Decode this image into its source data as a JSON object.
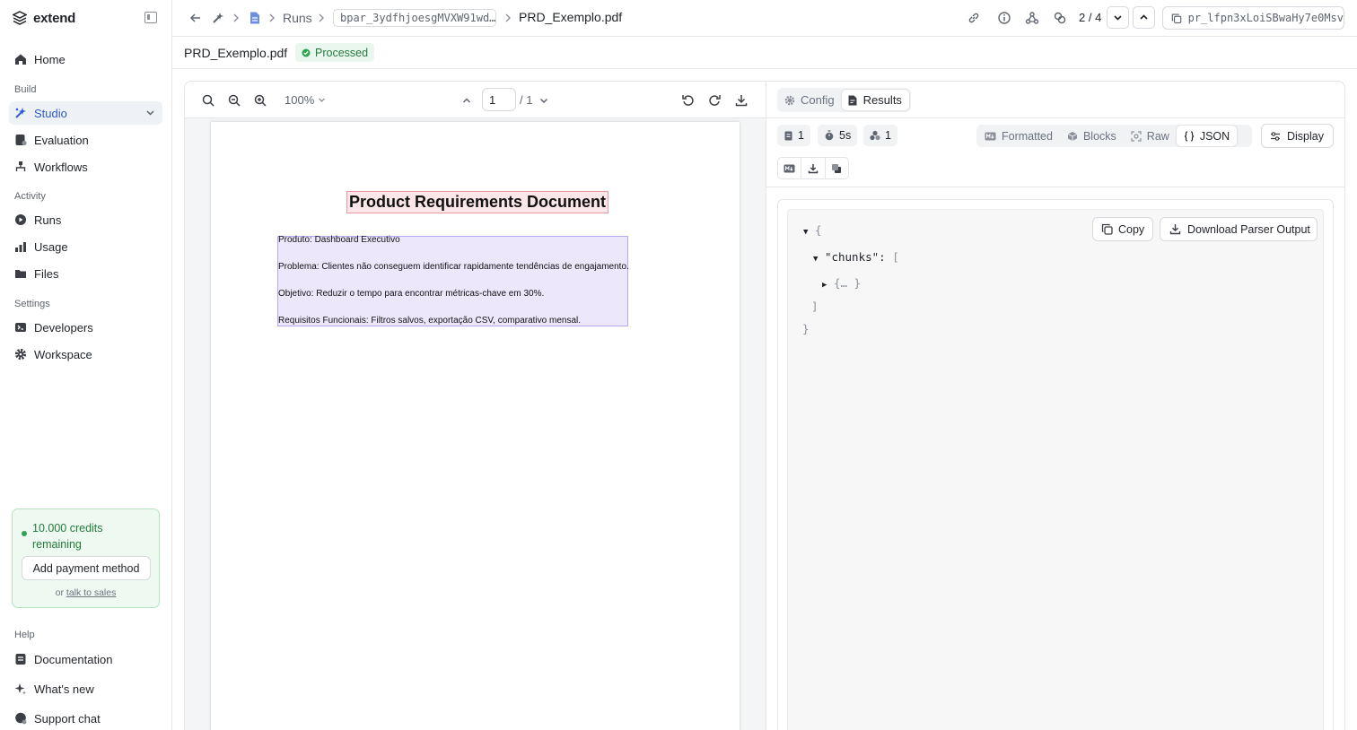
{
  "app": {
    "name": "extend"
  },
  "sidebar": {
    "home": "Home",
    "sections": {
      "build": "Build",
      "activity": "Activity",
      "settings": "Settings",
      "help": "Help"
    },
    "items": {
      "studio": "Studio",
      "evaluation": "Evaluation",
      "workflows": "Workflows",
      "runs": "Runs",
      "usage": "Usage",
      "files": "Files",
      "developers": "Developers",
      "workspace": "Workspace",
      "documentation": "Documentation",
      "whats_new": "What's new",
      "support_chat": "Support chat"
    },
    "credits": {
      "text": "10.000 credits remaining",
      "button": "Add payment method",
      "or": "or",
      "sales_link": "talk to sales"
    }
  },
  "header": {
    "breadcrumb_runs": "Runs",
    "run_id": "bpar_3ydfhjoesgMVXW91wd…",
    "file_name": "PRD_Exemplo.pdf",
    "pager": "2 / 4",
    "processor_id": "pr_lfpn3xLoiSBwaHy7e0Msv"
  },
  "subheader": {
    "title": "PRD_Exemplo.pdf",
    "status": "Processed"
  },
  "viewer": {
    "zoom": "100%",
    "page_current": "1",
    "page_total": "/ 1",
    "document": {
      "title": "Product Requirements Document",
      "lines": [
        "Produto: Dashboard Executivo",
        "Problema: Clientes não conseguem identificar rapidamente tendências de engajamento.",
        "Objetivo: Reduzir o tempo para encontrar métricas-chave em 30%.",
        "Requisitos Funcionais: Filtros salvos, exportação CSV, comparativo mensal."
      ]
    }
  },
  "results": {
    "tabs": {
      "config": "Config",
      "results": "Results"
    },
    "meta": {
      "pages": "1",
      "duration": "5s",
      "chunks": "1"
    },
    "views": {
      "formatted": "Formatted",
      "blocks": "Blocks",
      "raw": "Raw",
      "json": "JSON"
    },
    "display": "Display",
    "copy": "Copy",
    "download": "Download Parser Output",
    "json": {
      "open_brace": "{",
      "key": "\"chunks\":",
      "open_bracket": "[",
      "collapsed": "{… }",
      "close_bracket": "]",
      "close_brace": "}"
    }
  },
  "colors": {
    "accent": "#2f5bd3",
    "success": "#237a3b",
    "title_highlight": "#fbe7ea",
    "text_highlight": "#ece7fb"
  }
}
